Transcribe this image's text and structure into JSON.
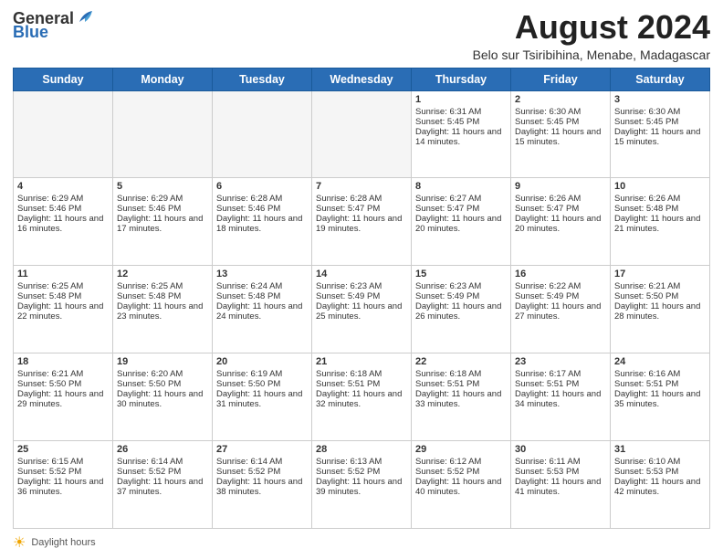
{
  "header": {
    "logo_general": "General",
    "logo_blue": "Blue",
    "month_title": "August 2024",
    "location": "Belo sur Tsiribihina, Menabe, Madagascar"
  },
  "days_of_week": [
    "Sunday",
    "Monday",
    "Tuesday",
    "Wednesday",
    "Thursday",
    "Friday",
    "Saturday"
  ],
  "footer": {
    "sun_icon": "☀",
    "daylight_label": "Daylight hours"
  },
  "weeks": [
    [
      {
        "day": "",
        "empty": true
      },
      {
        "day": "",
        "empty": true
      },
      {
        "day": "",
        "empty": true
      },
      {
        "day": "",
        "empty": true
      },
      {
        "day": "1",
        "sunrise": "Sunrise: 6:31 AM",
        "sunset": "Sunset: 5:45 PM",
        "daylight": "Daylight: 11 hours and 14 minutes."
      },
      {
        "day": "2",
        "sunrise": "Sunrise: 6:30 AM",
        "sunset": "Sunset: 5:45 PM",
        "daylight": "Daylight: 11 hours and 15 minutes."
      },
      {
        "day": "3",
        "sunrise": "Sunrise: 6:30 AM",
        "sunset": "Sunset: 5:45 PM",
        "daylight": "Daylight: 11 hours and 15 minutes."
      }
    ],
    [
      {
        "day": "4",
        "sunrise": "Sunrise: 6:29 AM",
        "sunset": "Sunset: 5:46 PM",
        "daylight": "Daylight: 11 hours and 16 minutes."
      },
      {
        "day": "5",
        "sunrise": "Sunrise: 6:29 AM",
        "sunset": "Sunset: 5:46 PM",
        "daylight": "Daylight: 11 hours and 17 minutes."
      },
      {
        "day": "6",
        "sunrise": "Sunrise: 6:28 AM",
        "sunset": "Sunset: 5:46 PM",
        "daylight": "Daylight: 11 hours and 18 minutes."
      },
      {
        "day": "7",
        "sunrise": "Sunrise: 6:28 AM",
        "sunset": "Sunset: 5:47 PM",
        "daylight": "Daylight: 11 hours and 19 minutes."
      },
      {
        "day": "8",
        "sunrise": "Sunrise: 6:27 AM",
        "sunset": "Sunset: 5:47 PM",
        "daylight": "Daylight: 11 hours and 20 minutes."
      },
      {
        "day": "9",
        "sunrise": "Sunrise: 6:26 AM",
        "sunset": "Sunset: 5:47 PM",
        "daylight": "Daylight: 11 hours and 20 minutes."
      },
      {
        "day": "10",
        "sunrise": "Sunrise: 6:26 AM",
        "sunset": "Sunset: 5:48 PM",
        "daylight": "Daylight: 11 hours and 21 minutes."
      }
    ],
    [
      {
        "day": "11",
        "sunrise": "Sunrise: 6:25 AM",
        "sunset": "Sunset: 5:48 PM",
        "daylight": "Daylight: 11 hours and 22 minutes."
      },
      {
        "day": "12",
        "sunrise": "Sunrise: 6:25 AM",
        "sunset": "Sunset: 5:48 PM",
        "daylight": "Daylight: 11 hours and 23 minutes."
      },
      {
        "day": "13",
        "sunrise": "Sunrise: 6:24 AM",
        "sunset": "Sunset: 5:48 PM",
        "daylight": "Daylight: 11 hours and 24 minutes."
      },
      {
        "day": "14",
        "sunrise": "Sunrise: 6:23 AM",
        "sunset": "Sunset: 5:49 PM",
        "daylight": "Daylight: 11 hours and 25 minutes."
      },
      {
        "day": "15",
        "sunrise": "Sunrise: 6:23 AM",
        "sunset": "Sunset: 5:49 PM",
        "daylight": "Daylight: 11 hours and 26 minutes."
      },
      {
        "day": "16",
        "sunrise": "Sunrise: 6:22 AM",
        "sunset": "Sunset: 5:49 PM",
        "daylight": "Daylight: 11 hours and 27 minutes."
      },
      {
        "day": "17",
        "sunrise": "Sunrise: 6:21 AM",
        "sunset": "Sunset: 5:50 PM",
        "daylight": "Daylight: 11 hours and 28 minutes."
      }
    ],
    [
      {
        "day": "18",
        "sunrise": "Sunrise: 6:21 AM",
        "sunset": "Sunset: 5:50 PM",
        "daylight": "Daylight: 11 hours and 29 minutes."
      },
      {
        "day": "19",
        "sunrise": "Sunrise: 6:20 AM",
        "sunset": "Sunset: 5:50 PM",
        "daylight": "Daylight: 11 hours and 30 minutes."
      },
      {
        "day": "20",
        "sunrise": "Sunrise: 6:19 AM",
        "sunset": "Sunset: 5:50 PM",
        "daylight": "Daylight: 11 hours and 31 minutes."
      },
      {
        "day": "21",
        "sunrise": "Sunrise: 6:18 AM",
        "sunset": "Sunset: 5:51 PM",
        "daylight": "Daylight: 11 hours and 32 minutes."
      },
      {
        "day": "22",
        "sunrise": "Sunrise: 6:18 AM",
        "sunset": "Sunset: 5:51 PM",
        "daylight": "Daylight: 11 hours and 33 minutes."
      },
      {
        "day": "23",
        "sunrise": "Sunrise: 6:17 AM",
        "sunset": "Sunset: 5:51 PM",
        "daylight": "Daylight: 11 hours and 34 minutes."
      },
      {
        "day": "24",
        "sunrise": "Sunrise: 6:16 AM",
        "sunset": "Sunset: 5:51 PM",
        "daylight": "Daylight: 11 hours and 35 minutes."
      }
    ],
    [
      {
        "day": "25",
        "sunrise": "Sunrise: 6:15 AM",
        "sunset": "Sunset: 5:52 PM",
        "daylight": "Daylight: 11 hours and 36 minutes."
      },
      {
        "day": "26",
        "sunrise": "Sunrise: 6:14 AM",
        "sunset": "Sunset: 5:52 PM",
        "daylight": "Daylight: 11 hours and 37 minutes."
      },
      {
        "day": "27",
        "sunrise": "Sunrise: 6:14 AM",
        "sunset": "Sunset: 5:52 PM",
        "daylight": "Daylight: 11 hours and 38 minutes."
      },
      {
        "day": "28",
        "sunrise": "Sunrise: 6:13 AM",
        "sunset": "Sunset: 5:52 PM",
        "daylight": "Daylight: 11 hours and 39 minutes."
      },
      {
        "day": "29",
        "sunrise": "Sunrise: 6:12 AM",
        "sunset": "Sunset: 5:52 PM",
        "daylight": "Daylight: 11 hours and 40 minutes."
      },
      {
        "day": "30",
        "sunrise": "Sunrise: 6:11 AM",
        "sunset": "Sunset: 5:53 PM",
        "daylight": "Daylight: 11 hours and 41 minutes."
      },
      {
        "day": "31",
        "sunrise": "Sunrise: 6:10 AM",
        "sunset": "Sunset: 5:53 PM",
        "daylight": "Daylight: 11 hours and 42 minutes."
      }
    ]
  ]
}
